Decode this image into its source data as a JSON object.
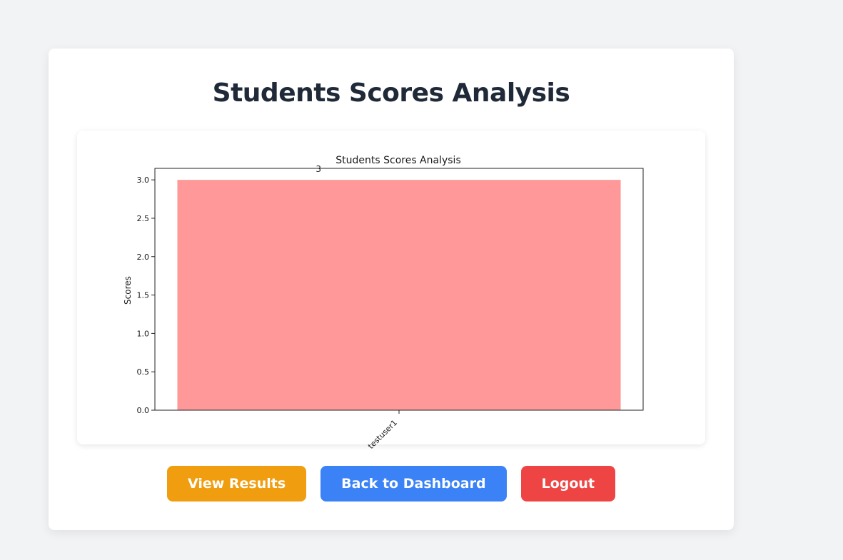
{
  "page": {
    "title": "Students Scores Analysis"
  },
  "chart_data": {
    "type": "bar",
    "title": "Students Scores Analysis",
    "xlabel": "",
    "ylabel": "Scores",
    "categories": [
      "testuser1"
    ],
    "values": [
      3
    ],
    "data_labels": [
      "3"
    ],
    "ylim": [
      0,
      3.15
    ],
    "yticks": [
      0.0,
      0.5,
      1.0,
      1.5,
      2.0,
      2.5,
      3.0
    ],
    "ytick_labels": [
      "0.0",
      "0.5",
      "1.0",
      "1.5",
      "2.0",
      "2.5",
      "3.0"
    ],
    "bar_color": "#ff9999",
    "grid": false,
    "legend": "none"
  },
  "buttons": {
    "view_results": "View Results",
    "back_to_dashboard": "Back to Dashboard",
    "logout": "Logout"
  },
  "colors": {
    "background": "#f2f3f5",
    "card": "#ffffff",
    "title": "#1f2937",
    "view_results": "#f09e10",
    "back_to_dashboard": "#3b82f6",
    "logout": "#ef4444"
  }
}
